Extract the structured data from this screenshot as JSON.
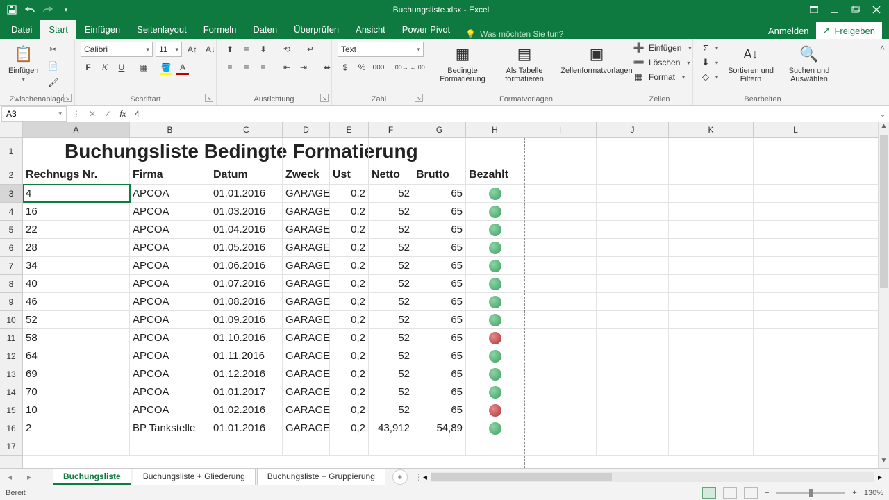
{
  "app": {
    "title": "Buchungsliste.xlsx - Excel"
  },
  "tabs": {
    "file": "Datei",
    "items": [
      "Start",
      "Einfügen",
      "Seitenlayout",
      "Formeln",
      "Daten",
      "Überprüfen",
      "Ansicht",
      "Power Pivot"
    ],
    "active": "Start",
    "tellme_placeholder": "Was möchten Sie tun?",
    "signin": "Anmelden",
    "share": "Freigeben"
  },
  "ribbon": {
    "clipboard": {
      "label": "Zwischenablage",
      "paste": "Einfügen"
    },
    "font": {
      "label": "Schriftart",
      "name": "Calibri",
      "size": "11",
      "bold": "F",
      "italic": "K",
      "underline": "U"
    },
    "alignment": {
      "label": "Ausrichtung"
    },
    "number": {
      "label": "Zahl",
      "format": "Text"
    },
    "styles": {
      "label": "Formatvorlagen",
      "cond": "Bedingte Formatierung",
      "astable": "Als Tabelle formatieren",
      "cellstyles": "Zellenformatvorlagen"
    },
    "cells": {
      "label": "Zellen",
      "insert": "Einfügen",
      "delete": "Löschen",
      "format": "Format"
    },
    "editing": {
      "label": "Bearbeiten",
      "sortfilter": "Sortieren und Filtern",
      "findselect": "Suchen und Auswählen"
    }
  },
  "formula": {
    "namebox": "A3",
    "fx_label": "fx",
    "value": "4"
  },
  "columns": [
    {
      "letter": "A",
      "w": 154
    },
    {
      "letter": "B",
      "w": 116
    },
    {
      "letter": "C",
      "w": 104
    },
    {
      "letter": "D",
      "w": 68
    },
    {
      "letter": "E",
      "w": 56
    },
    {
      "letter": "F",
      "w": 64
    },
    {
      "letter": "G",
      "w": 76
    },
    {
      "letter": "H",
      "w": 84
    },
    {
      "letter": "I",
      "w": 104
    },
    {
      "letter": "J",
      "w": 104
    },
    {
      "letter": "K",
      "w": 122
    },
    {
      "letter": "L",
      "w": 122
    }
  ],
  "sheet_title": "Buchungsliste Bedingte Formatierung",
  "headers": [
    "Rechnugs Nr.",
    "Firma",
    "Datum",
    "Zweck",
    "Ust",
    "Netto",
    "Brutto",
    "Bezahlt"
  ],
  "rows": [
    {
      "n": 3,
      "a": "4",
      "b": "APCOA",
      "c": "01.01.2016",
      "d": "GARAGE",
      "e": "0,2",
      "f": "52",
      "g": "65",
      "paid": "green"
    },
    {
      "n": 4,
      "a": "16",
      "b": "APCOA",
      "c": "01.03.2016",
      "d": "GARAGE",
      "e": "0,2",
      "f": "52",
      "g": "65",
      "paid": "green"
    },
    {
      "n": 5,
      "a": "22",
      "b": "APCOA",
      "c": "01.04.2016",
      "d": "GARAGE",
      "e": "0,2",
      "f": "52",
      "g": "65",
      "paid": "green"
    },
    {
      "n": 6,
      "a": "28",
      "b": "APCOA",
      "c": "01.05.2016",
      "d": "GARAGE",
      "e": "0,2",
      "f": "52",
      "g": "65",
      "paid": "green"
    },
    {
      "n": 7,
      "a": "34",
      "b": "APCOA",
      "c": "01.06.2016",
      "d": "GARAGE",
      "e": "0,2",
      "f": "52",
      "g": "65",
      "paid": "green"
    },
    {
      "n": 8,
      "a": "40",
      "b": "APCOA",
      "c": "01.07.2016",
      "d": "GARAGE",
      "e": "0,2",
      "f": "52",
      "g": "65",
      "paid": "green"
    },
    {
      "n": 9,
      "a": "46",
      "b": "APCOA",
      "c": "01.08.2016",
      "d": "GARAGE",
      "e": "0,2",
      "f": "52",
      "g": "65",
      "paid": "green"
    },
    {
      "n": 10,
      "a": "52",
      "b": "APCOA",
      "c": "01.09.2016",
      "d": "GARAGE",
      "e": "0,2",
      "f": "52",
      "g": "65",
      "paid": "green"
    },
    {
      "n": 11,
      "a": "58",
      "b": "APCOA",
      "c": "01.10.2016",
      "d": "GARAGE",
      "e": "0,2",
      "f": "52",
      "g": "65",
      "paid": "red"
    },
    {
      "n": 12,
      "a": "64",
      "b": "APCOA",
      "c": "01.11.2016",
      "d": "GARAGE",
      "e": "0,2",
      "f": "52",
      "g": "65",
      "paid": "green"
    },
    {
      "n": 13,
      "a": "69",
      "b": "APCOA",
      "c": "01.12.2016",
      "d": "GARAGE",
      "e": "0,2",
      "f": "52",
      "g": "65",
      "paid": "green"
    },
    {
      "n": 14,
      "a": "70",
      "b": "APCOA",
      "c": "01.01.2017",
      "d": "GARAGE",
      "e": "0,2",
      "f": "52",
      "g": "65",
      "paid": "green"
    },
    {
      "n": 15,
      "a": "10",
      "b": "APCOA",
      "c": "01.02.2016",
      "d": "GARAGE",
      "e": "0,2",
      "f": "52",
      "g": "65",
      "paid": "red"
    },
    {
      "n": 16,
      "a": "2",
      "b": "BP Tankstelle",
      "c": "01.01.2016",
      "d": "GARAGE",
      "e": "0,2",
      "f": "43,912",
      "g": "54,89",
      "paid": "green"
    }
  ],
  "sheettabs": {
    "items": [
      "Buchungsliste",
      "Buchungsliste + Gliederung",
      "Buchungsliste + Gruppierung"
    ],
    "active": 0
  },
  "status": {
    "ready": "Bereit",
    "zoom": "130%"
  },
  "colors": {
    "brand": "#0f7a3f"
  }
}
